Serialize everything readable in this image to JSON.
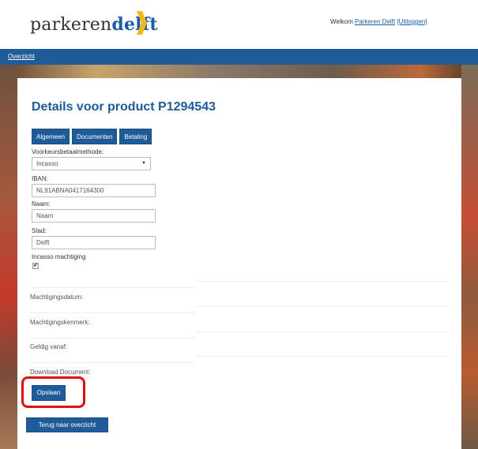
{
  "brand": {
    "part1": "parkeren",
    "part2": "delft"
  },
  "header": {
    "welcome_prefix": "Welkom",
    "user_link": "Parkeren Delft",
    "logout_link": "[Uitloggen]"
  },
  "nav": {
    "overview": "Overzicht"
  },
  "page": {
    "title": "Details voor product P1294543"
  },
  "tabs": [
    "Algemeen",
    "Documenten",
    "Betaling"
  ],
  "form": {
    "payment_method_label": "Voorkeursbetaalmethode:",
    "payment_method_value": "Incasso",
    "iban_label": "IBAN:",
    "iban_value": "NL91ABNA0417164300",
    "name_label": "Naam:",
    "name_placeholder": "Naam",
    "city_label": "Stad:",
    "city_value": "Delft",
    "mandate_label": "Incasso machtiging",
    "mandate_checked": true
  },
  "details": {
    "mandate_date_label": "Machtigingsdatum:",
    "mandate_ref_label": "Machtigingskenmerk:",
    "valid_from_label": "Geldig vanaf:",
    "download_label": "Download Document:"
  },
  "buttons": {
    "save": "Opslaan",
    "back": "Terug naar overzicht"
  },
  "colors": {
    "primary": "#1e5b98",
    "highlight": "#e01010"
  }
}
